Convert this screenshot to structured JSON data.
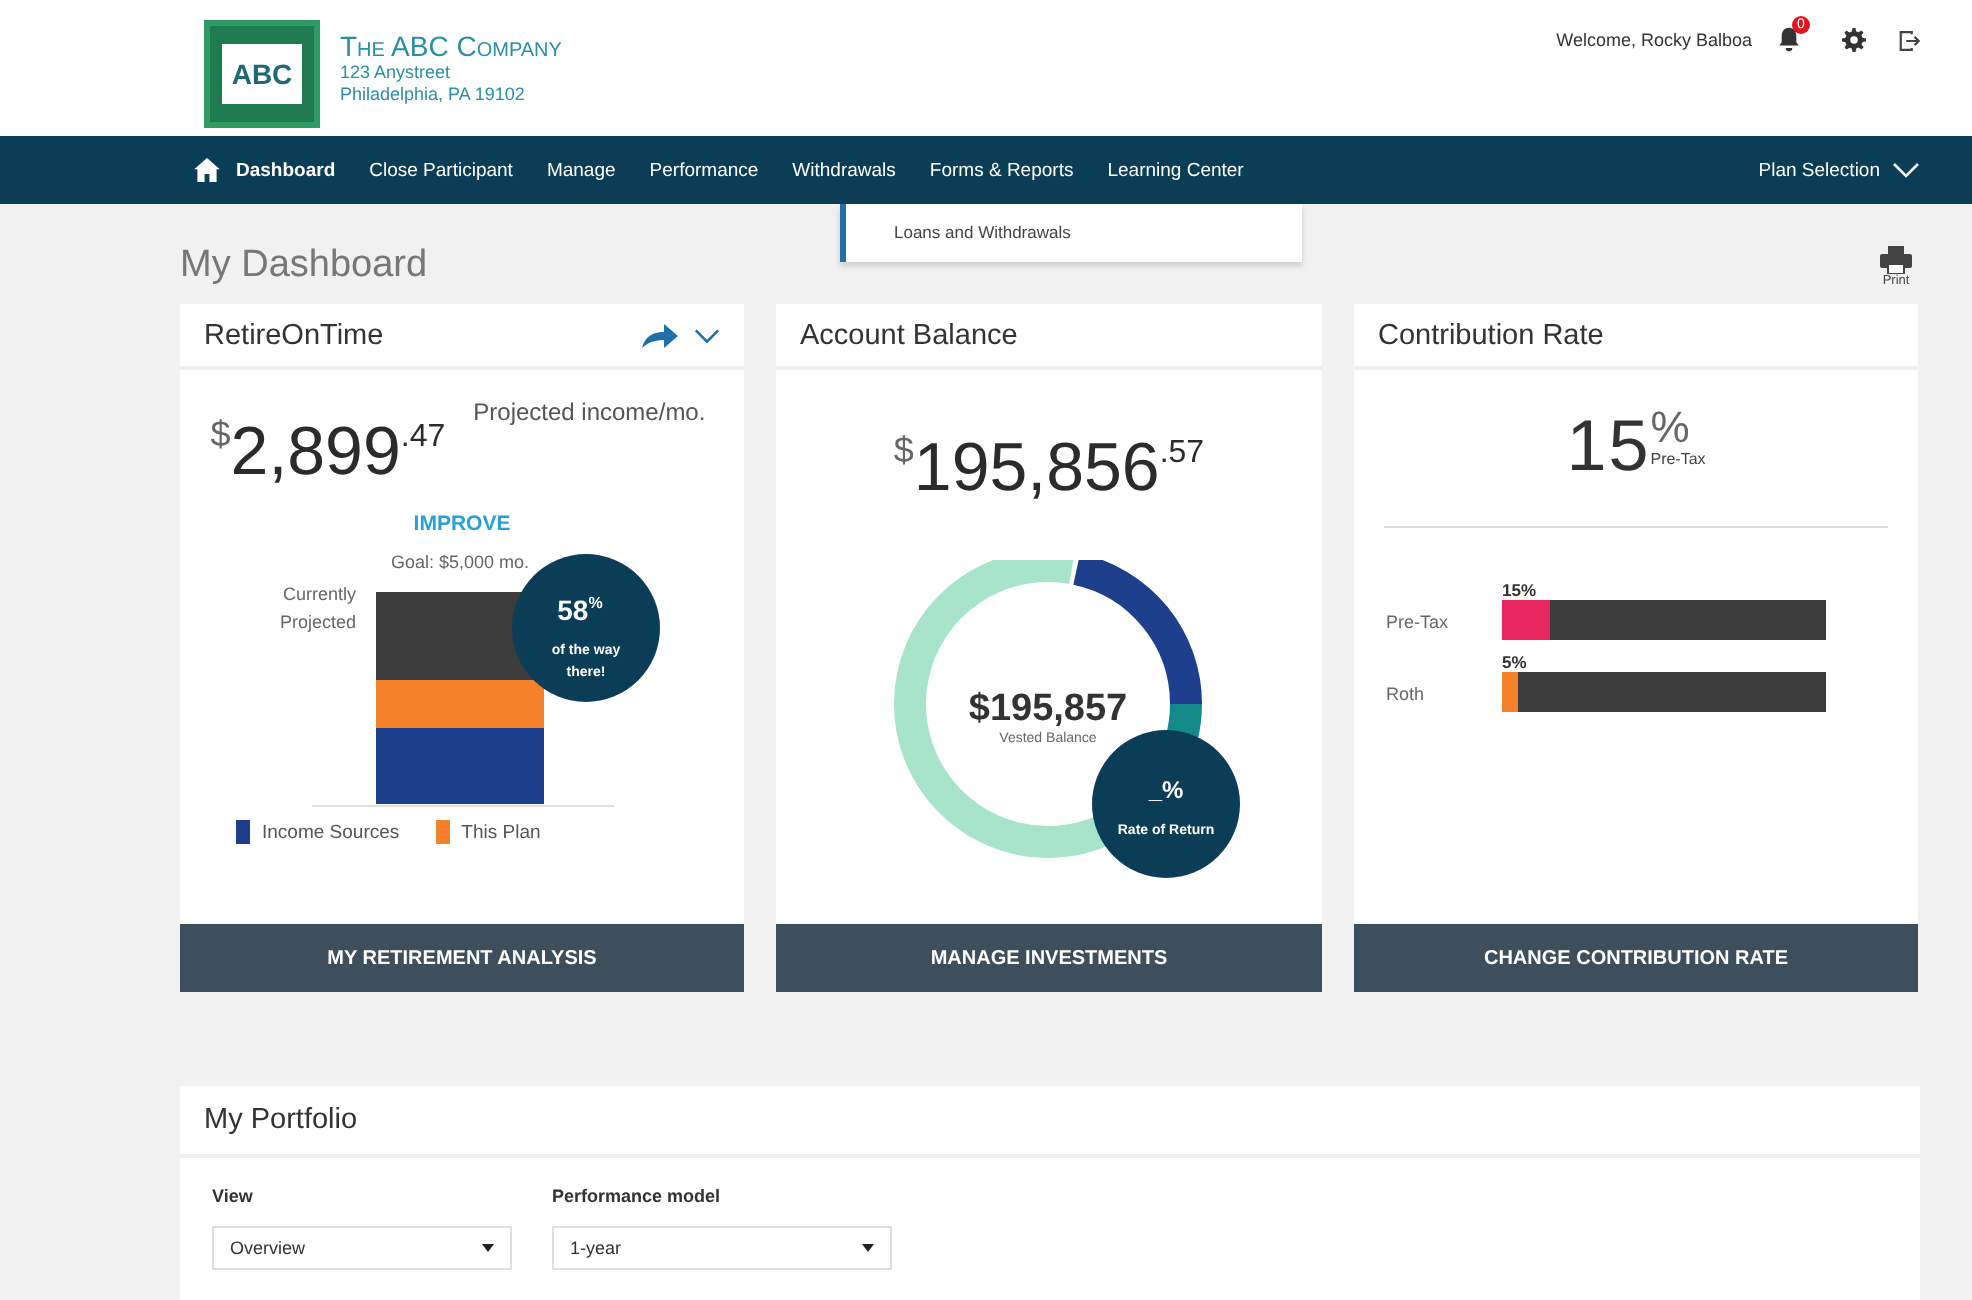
{
  "header": {
    "logo": "ABC",
    "company": "The ABC Company",
    "address_line_1": "123 Anystreet",
    "address_line_2": "Philadelphia, PA 19102",
    "welcome": "Welcome,  Rocky Balboa",
    "notification_count": "0"
  },
  "nav": {
    "items": [
      {
        "label": "Dashboard",
        "selected": true
      },
      {
        "label": "Close Participant",
        "selected": false
      },
      {
        "label": "Manage",
        "selected": false
      },
      {
        "label": "Performance",
        "selected": false
      },
      {
        "label": "Withdrawals",
        "selected": false
      },
      {
        "label": "Forms & Reports",
        "selected": false
      },
      {
        "label": "Learning Center",
        "selected": false
      }
    ],
    "plan_selection": "Plan Selection",
    "open_menu": {
      "items": [
        "Loans and Withdrawals"
      ]
    }
  },
  "page_title": "My Dashboard",
  "print_label": "Print",
  "retire_on_time": {
    "title": "RetireOnTime",
    "currency": "$",
    "whole": "2,899",
    "cents": ".47",
    "label": "Projected income/mo.",
    "improve": "IMPROVE",
    "goal": "Goal: $5,000 mo.",
    "projected_label_1": "Currently",
    "projected_label_2": "Projected",
    "badge": {
      "percent": "58",
      "unit": "%",
      "caption_1": "of the way",
      "caption_2": "there!"
    },
    "legend": [
      {
        "label": "Income Sources",
        "color": "#1d3f8c"
      },
      {
        "label": "This Plan",
        "color": "#f5822a"
      }
    ],
    "button": "MY RETIREMENT ANALYSIS"
  },
  "account_balance": {
    "title": "Account Balance",
    "currency": "$",
    "whole": "195,856",
    "cents": ".57",
    "vested_amount": "$195,857",
    "vested_label": "Vested Balance",
    "badge": {
      "value": "_%",
      "caption": "Rate of Return"
    },
    "button": "MANAGE INVESTMENTS"
  },
  "contribution_rate": {
    "title": "Contribution Rate",
    "rate": "15",
    "unit": "%",
    "rate_label": "Pre-Tax",
    "bars": [
      {
        "label": "Pre-Tax",
        "value": "15%",
        "level": 0.15,
        "color": "#e8265e"
      },
      {
        "label": "Roth",
        "value": "5%",
        "level": 0.05,
        "color": "#f5822a"
      }
    ],
    "button": "CHANGE CONTRIBUTION RATE"
  },
  "portfolio": {
    "title": "My Portfolio",
    "fields": [
      {
        "label": "View",
        "value": "Overview"
      },
      {
        "label": "Performance model",
        "value": "1-year"
      }
    ]
  }
}
